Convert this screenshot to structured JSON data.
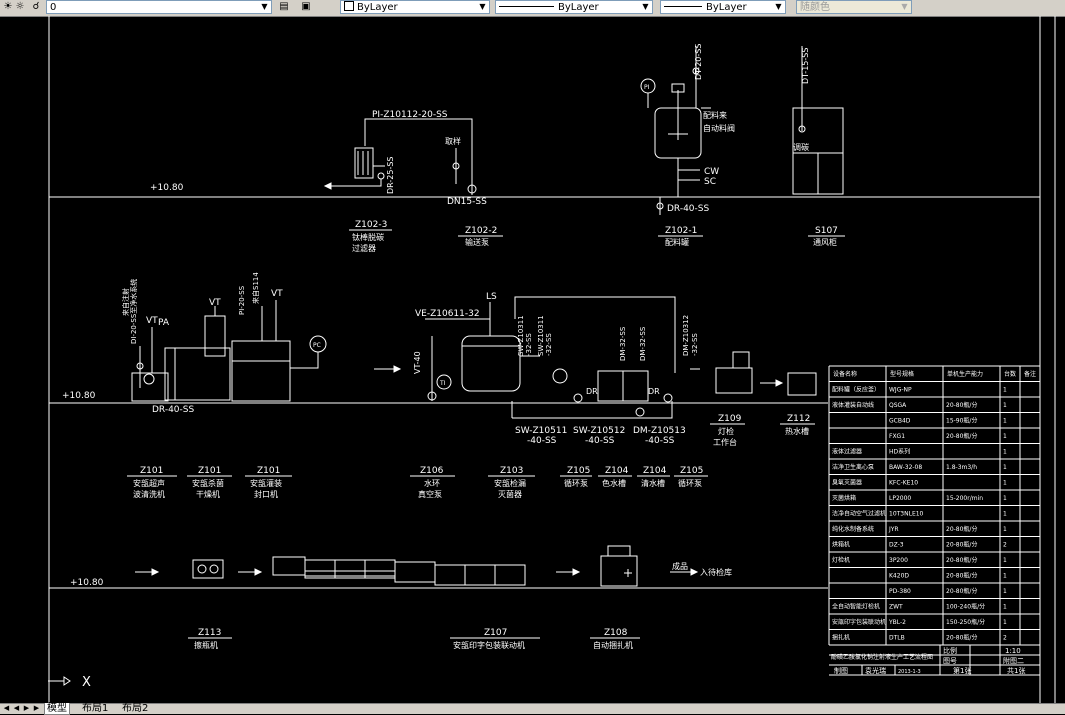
{
  "toolbar": {
    "layer_value": "0",
    "color_value": "ByLayer",
    "linetype_value": "ByLayer",
    "lineweight_value": "ByLayer",
    "plotstyle_value": "随颜色"
  },
  "colors": {
    "background": "#000000",
    "lines": "#ffffff"
  },
  "tabs": [
    "模型",
    "布局1",
    "布局2"
  ],
  "drawing": {
    "levels": {
      "top": "+10.80",
      "mid": "+10.80",
      "bottom": "+10.80"
    },
    "labels": {
      "pi_line": "PI-Z10112-20-SS",
      "dn15": "DN15-SS",
      "dr40_top": "DR-40-SS",
      "dr25": "DR-25-SS",
      "sample": "取样",
      "dt20": "DT-20-SS",
      "dt15": "DT-15-SS",
      "feed1": "配料来",
      "feed2": "自动料阀",
      "cw": "CW",
      "sc": "SC",
      "vent": "调碳",
      "ve_line": "VE-Z10611-32",
      "ls": "LS",
      "vt40": "VT-40",
      "vt_a": "VT",
      "vt_b": "VT",
      "vt_c": "VT",
      "pa": "PA",
      "dt20_mid": "DT-20-SS",
      "mid_vert_a": "来自注射",
      "mid_vert_b": "DI-20-SS至净水系统",
      "mid_vert_c": "来自S114",
      "pi_mid": "PI-20-SS",
      "dr40_mid": "DR-40-SS",
      "sw0311": "SW-Z10311",
      "sw0311b": "-32-SS",
      "sw0311c": "SW-Z10311",
      "sw0311d": "-32-SS",
      "dm32a": "DM-32-SS",
      "dm32b": "DM-32-SS",
      "dm_z10312": "DM-Z10312",
      "dm_z10312b": "-32-SS",
      "dr_a": "DR",
      "dr_b": "DR",
      "sw10511": "SW-Z10511",
      "sw10511b": "-40-SS",
      "sw10512": "SW-Z10512",
      "sw10512b": "-40-SS",
      "dm10513": "DM-Z10513",
      "dm10513b": "-40-SS",
      "finished": "成品",
      "to_store": "入待检库"
    },
    "equipment_top": [
      {
        "tag": "Z102-3",
        "line1": "钛棒脱碳",
        "line2": "过滤器"
      },
      {
        "tag": "Z102-2",
        "line1": "输送泵",
        "line2": ""
      },
      {
        "tag": "Z102-1",
        "line1": "配料罐",
        "line2": ""
      },
      {
        "tag": "S107",
        "line1": "通风柜",
        "line2": ""
      }
    ],
    "equipment_mid": [
      {
        "tag": "Z109",
        "line1": "灯检",
        "line2": "工作台"
      },
      {
        "tag": "Z112",
        "line1": "热水槽",
        "line2": ""
      }
    ],
    "equipment_row": [
      {
        "tag": "Z101",
        "line1": "安瓿超声",
        "line2": "波清洗机"
      },
      {
        "tag": "Z101",
        "line1": "安瓿杀菌",
        "line2": "干燥机"
      },
      {
        "tag": "Z101",
        "line1": "安瓿灌装",
        "line2": "封口机"
      },
      {
        "tag": "Z106",
        "line1": "水环",
        "line2": "真空泵"
      },
      {
        "tag": "Z103",
        "line1": "安瓿检漏",
        "line2": "灭菌器"
      },
      {
        "tag": "Z105",
        "line1": "循环泵",
        "line2": ""
      },
      {
        "tag": "Z104",
        "line1": "色水槽",
        "line2": ""
      },
      {
        "tag": "Z104",
        "line1": "清水槽",
        "line2": ""
      },
      {
        "tag": "Z105",
        "line1": "循环泵",
        "line2": ""
      }
    ],
    "equipment_bottom": [
      {
        "tag": "Z113",
        "line1": "擦瓶机",
        "line2": ""
      },
      {
        "tag": "Z107",
        "line1": "安瓿印字包装联动机",
        "line2": ""
      },
      {
        "tag": "Z108",
        "line1": "自动捆扎机",
        "line2": ""
      }
    ],
    "gauge_pi": "PI",
    "gauge_pc": "PC",
    "gauge_ti": "TI"
  },
  "table": {
    "headers": [
      "设备名称",
      "型号规格",
      "单机生产能力",
      "台数",
      "备注"
    ],
    "rows": [
      [
        "配料罐（反应釜）",
        "WJG-NP",
        "",
        "1",
        ""
      ],
      [
        "液体灌装自动线",
        "QSGA",
        "20-80瓶/分",
        "1",
        ""
      ],
      [
        "",
        "GCB4D",
        "15-90瓶/分",
        "1",
        ""
      ],
      [
        "",
        "FXG1",
        "20-80瓶/分",
        "1",
        ""
      ],
      [
        "液体过滤器",
        "HD系列",
        "",
        "1",
        ""
      ],
      [
        "洁净卫生离心泵",
        "BAW-32-08",
        "1.8-3m3/h",
        "1",
        ""
      ],
      [
        "臭氧灭菌器",
        "KFC-KE10",
        "",
        "1",
        ""
      ],
      [
        "灭菌烘箱",
        "LP2000",
        "15-200r/min",
        "1",
        ""
      ],
      [
        "洁净自动空气过滤机",
        "10T3NLE10",
        "",
        "1",
        ""
      ],
      [
        "纯化水制备系统",
        "JYR",
        "20-80瓶/分",
        "1",
        ""
      ],
      [
        "烘箱机",
        "DZ-3",
        "20-80瓶/分",
        "2",
        ""
      ],
      [
        "灯检机",
        "3P200",
        "20-80瓶/分",
        "1",
        ""
      ],
      [
        "",
        "K420D",
        "20-80瓶/分",
        "1",
        ""
      ],
      [
        "",
        "PD-380",
        "20-80瓶/分",
        "1",
        ""
      ],
      [
        "全自动智能灯检机",
        "ZWT",
        "100-240瓶/分",
        "1",
        ""
      ],
      [
        "安瓿印字包装联动机",
        "YBL-2",
        "150-250瓶/分",
        "1",
        ""
      ],
      [
        "捆扎机",
        "DTLB",
        "20-80瓶/分",
        "2",
        ""
      ]
    ],
    "title": "酚磺乙胺氯化钠注射液生产工艺流程图",
    "scale_label": "比例",
    "scale_value": "1:10",
    "drawing_no_label": "图号",
    "drawing_no_value": "附图二",
    "drawn_by_label": "制图",
    "drawn_by_value": "袁光瑞",
    "date_value": "2013-1-3",
    "sheet_value": "第1张",
    "total_value": "共1张"
  }
}
